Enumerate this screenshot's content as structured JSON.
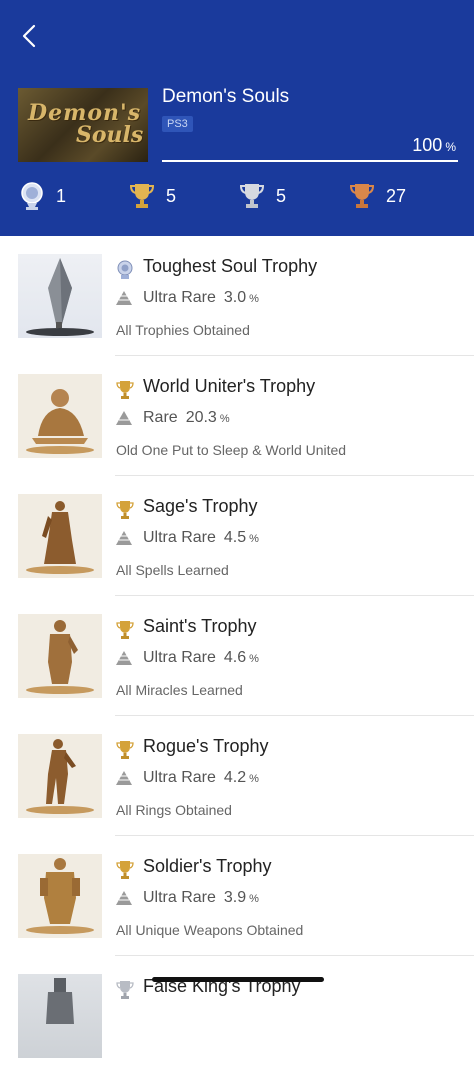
{
  "header": {
    "game_title": "Demon's Souls",
    "platform": "PS3",
    "progress_value": "100",
    "progress_unit": "%",
    "progress_fraction": 1.0,
    "art_text_line1": "Demon's",
    "art_text_line2": "Souls",
    "counts": [
      {
        "type": "platinum",
        "icon": "platinum-trophy-icon",
        "value": "1"
      },
      {
        "type": "gold",
        "icon": "gold-trophy-icon",
        "value": "5"
      },
      {
        "type": "silver",
        "icon": "silver-trophy-icon",
        "value": "5"
      },
      {
        "type": "bronze",
        "icon": "bronze-trophy-icon",
        "value": "27"
      }
    ]
  },
  "colors": {
    "header_bg": "#1a3a9c",
    "platinum": "#c9d3ea",
    "gold": "#d4a23a",
    "silver": "#c0c4cc",
    "bronze": "#c9763c"
  },
  "trophies": [
    {
      "name": "Toughest Soul Trophy",
      "grade": "platinum",
      "rarity": "Ultra Rare",
      "percent": "3.0",
      "unit": "%",
      "description": "All Trophies Obtained"
    },
    {
      "name": "World Uniter's Trophy",
      "grade": "gold",
      "rarity": "Rare",
      "percent": "20.3",
      "unit": "%",
      "description": "Old One Put to Sleep & World United"
    },
    {
      "name": "Sage's Trophy",
      "grade": "gold",
      "rarity": "Ultra Rare",
      "percent": "4.5",
      "unit": "%",
      "description": "All Spells Learned"
    },
    {
      "name": "Saint's Trophy",
      "grade": "gold",
      "rarity": "Ultra Rare",
      "percent": "4.6",
      "unit": "%",
      "description": "All Miracles Learned"
    },
    {
      "name": "Rogue's Trophy",
      "grade": "gold",
      "rarity": "Ultra Rare",
      "percent": "4.2",
      "unit": "%",
      "description": "All Rings Obtained"
    },
    {
      "name": "Soldier's Trophy",
      "grade": "gold",
      "rarity": "Ultra Rare",
      "percent": "3.9",
      "unit": "%",
      "description": "All Unique Weapons Obtained"
    },
    {
      "name": "False King's Trophy",
      "grade": "silver",
      "rarity": "",
      "percent": "",
      "unit": "",
      "description": ""
    }
  ]
}
